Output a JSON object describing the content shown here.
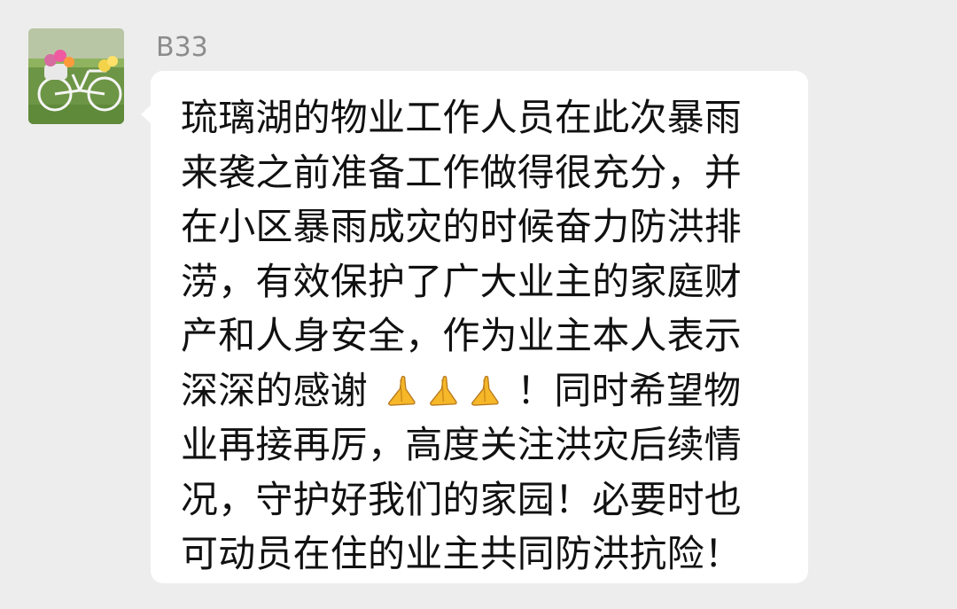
{
  "sender": {
    "name": "B33"
  },
  "message": {
    "lines": [
      "琉璃湖的物业工作人员在此次暴雨",
      "来袭之前准备工作做得很充分，并",
      "在小区暴雨成灾的时候奋力防洪排",
      "涝，有效保护了广大业主的家庭财",
      "产和人身安全，作为业主本人表示",
      "深深的感谢",
      "！同时希望物",
      "业再接再厉，高度关注洪灾后续情",
      "况，守护好我们的家园！必要时也",
      "可动员在住的业主共同防洪抗险！"
    ],
    "emoji_icons": [
      "folded-hands-icon",
      "folded-hands-icon",
      "folded-hands-icon"
    ]
  },
  "colors": {
    "background": "#ededed",
    "bubble": "#ffffff",
    "name": "#8c8c8c",
    "text": "#111111",
    "emoji": "#f6b728"
  }
}
